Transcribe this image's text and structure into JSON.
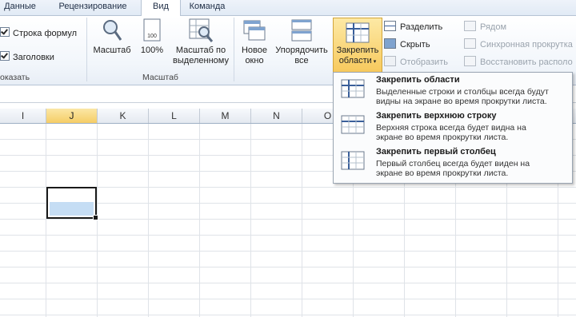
{
  "tabs": [
    "Данные",
    "Рецензирование",
    "Вид",
    "Команда"
  ],
  "show": {
    "formula_bar": "Строка формул",
    "headings": "Заголовки",
    "group_label": "оказать"
  },
  "zoom": {
    "zoom": "Масштаб",
    "hundred": "100%",
    "zoom_sel_1": "Масштаб по",
    "zoom_sel_2": "выделенному",
    "group_label": "Масштаб"
  },
  "window": {
    "new_1": "Новое",
    "new_2": "окно",
    "arrange_1": "Упорядочить",
    "arrange_2": "все",
    "freeze_1": "Закрепить",
    "freeze_2": "области",
    "split": "Разделить",
    "hide": "Скрыть",
    "unhide": "Отобразить",
    "side": "Рядом",
    "sync": "Синхронная прокрутка",
    "reset": "Восстановить располо"
  },
  "columns": [
    "I",
    "J",
    "K",
    "L",
    "M",
    "N",
    "O"
  ],
  "selected_column": "J",
  "menu": [
    {
      "title": "Закрепить области",
      "desc1": "Выделенные строки и столбцы всегда будут",
      "desc2": "видны на экране во время прокрутки листа."
    },
    {
      "title": "Закрепить верхнюю строку",
      "desc1": "Верхняя строка всегда будет видна на",
      "desc2": "экране во время прокрутки листа."
    },
    {
      "title": "Закрепить первый столбец",
      "desc1": "Первый столбец всегда будет виден на",
      "desc2": "экране во время прокрутки листа."
    }
  ]
}
